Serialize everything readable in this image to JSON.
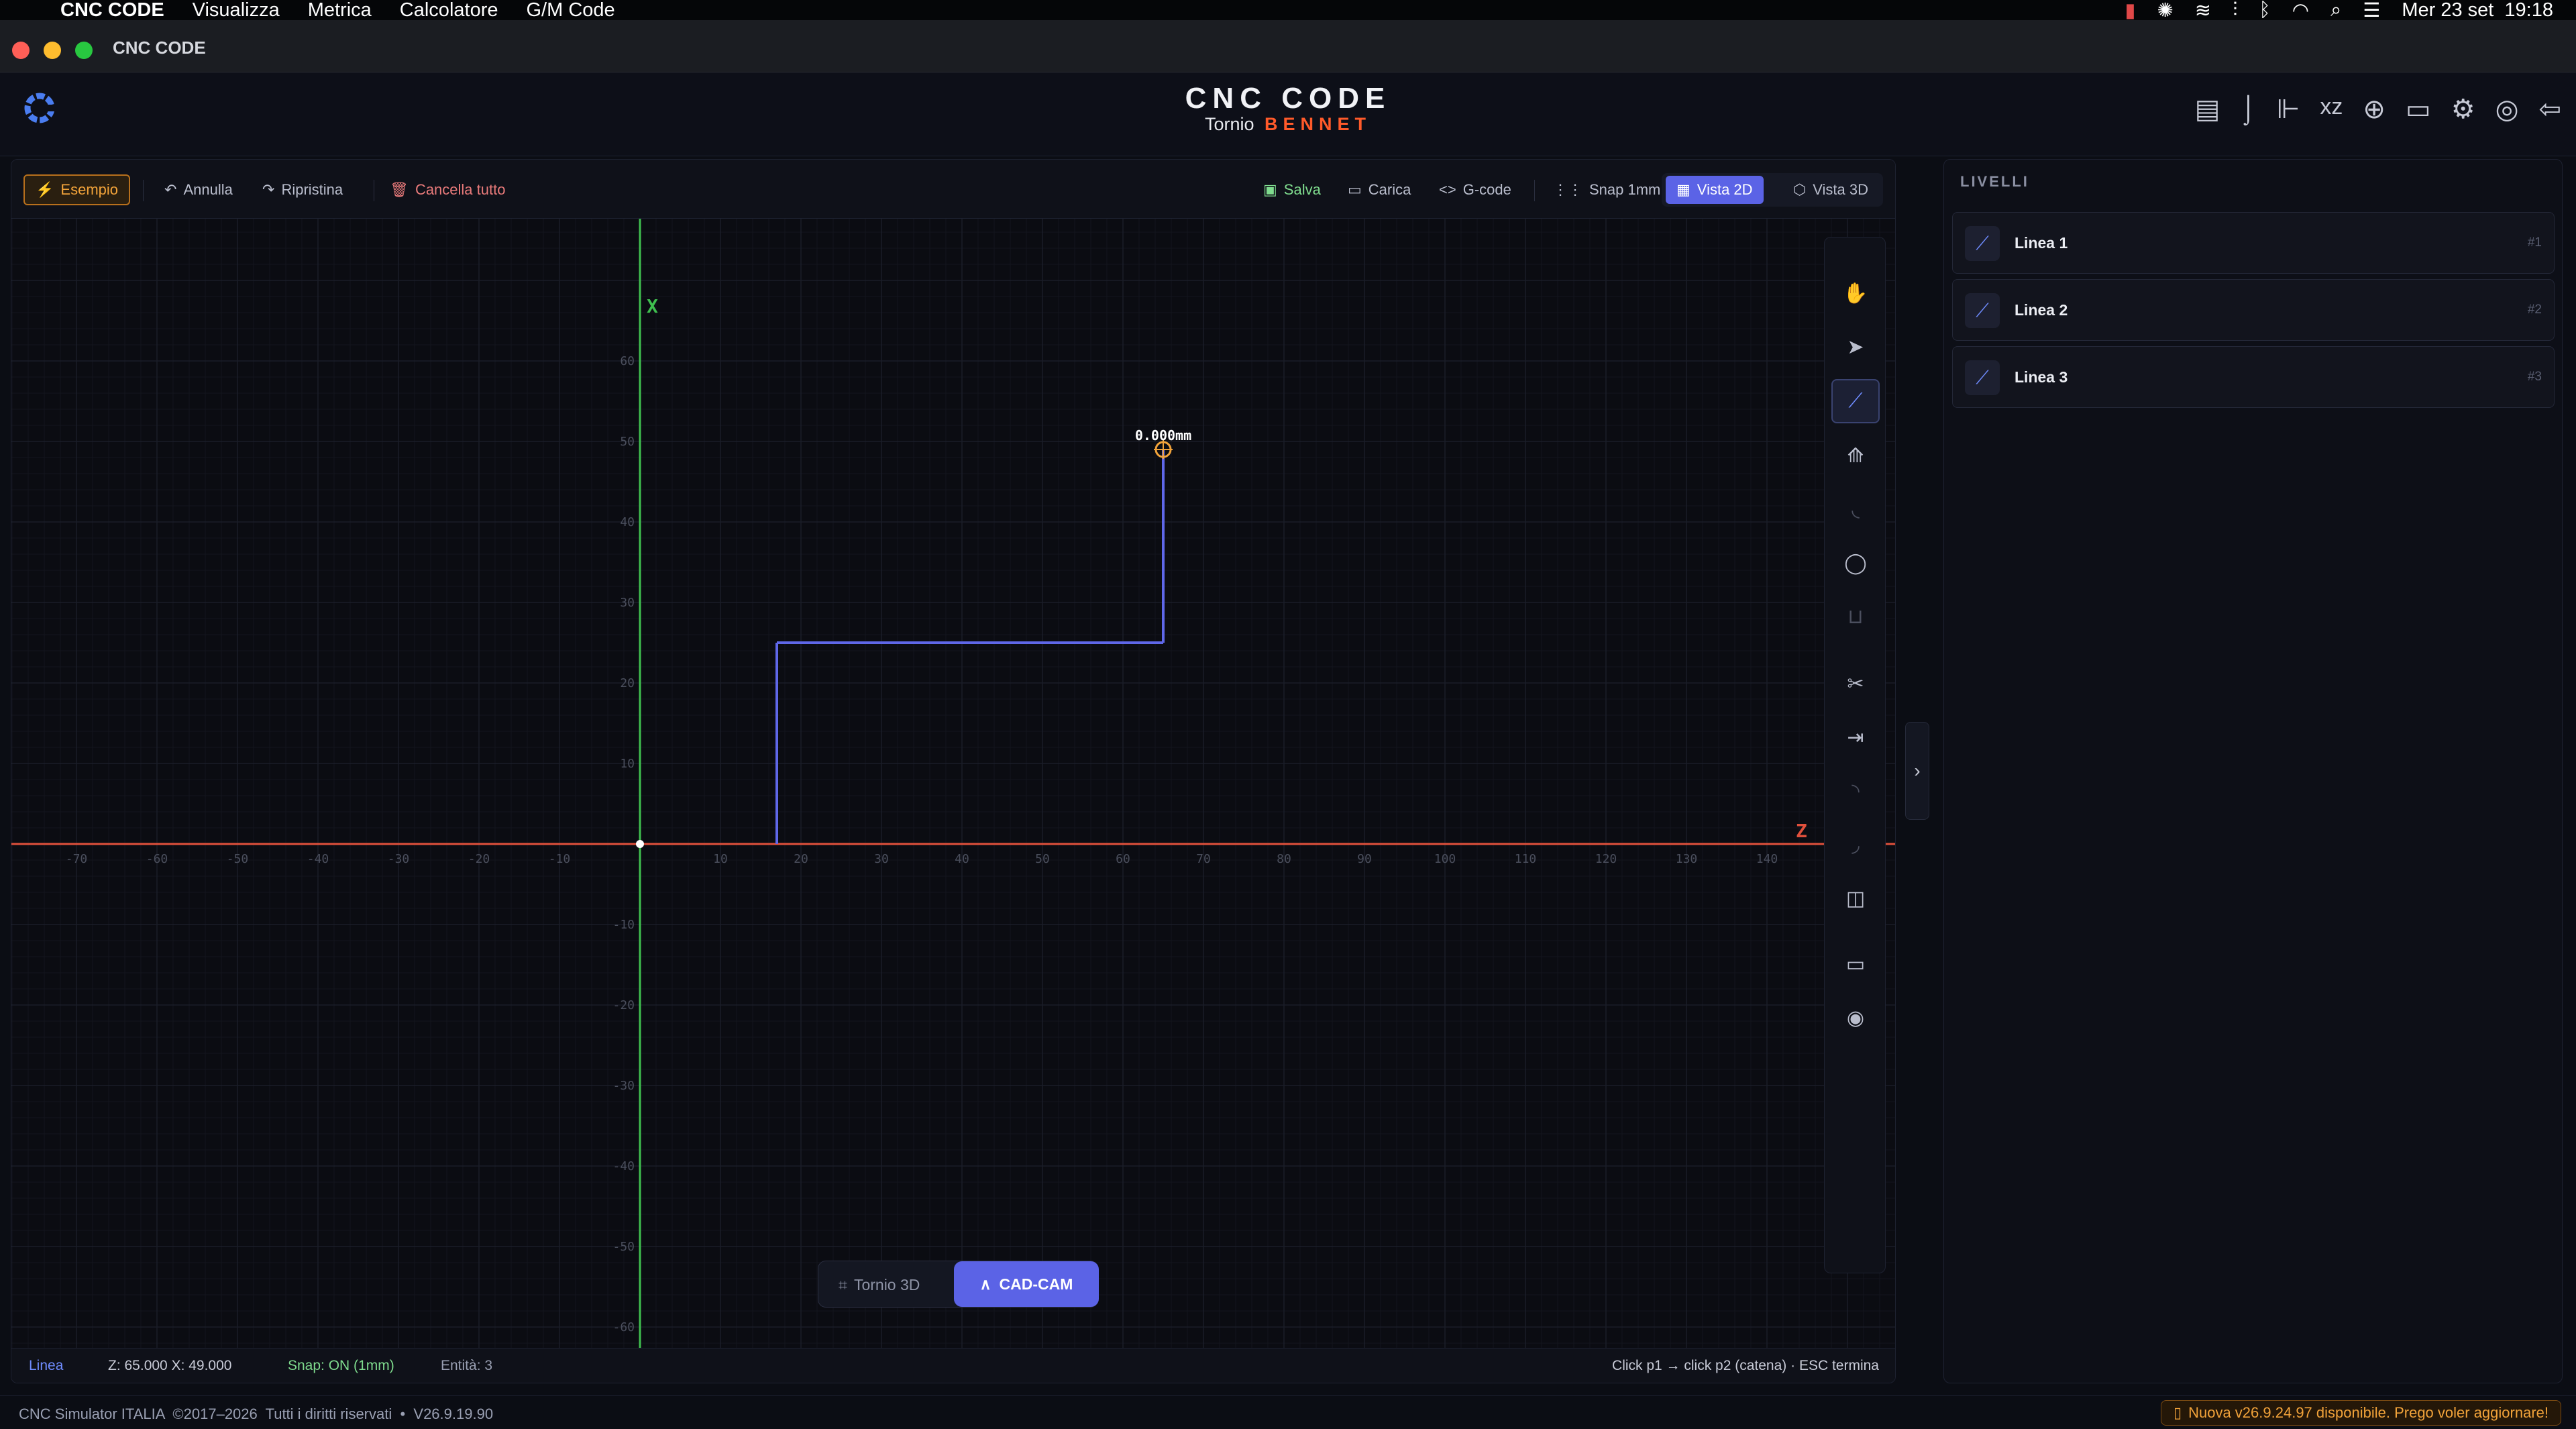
{
  "menubar": {
    "app": "CNC CODE",
    "items": [
      "Visualizza",
      "Metrica",
      "Calcolatore",
      "G/M Code"
    ],
    "clock": "Mer 23 set  19:18"
  },
  "window": {
    "title": "CNC CODE"
  },
  "header": {
    "brand": "CNC CODE",
    "subtitle_left": "Tornio",
    "subtitle_right": "BENNET"
  },
  "toolbar": {
    "example": "Esempio",
    "undo": "Annulla",
    "redo": "Ripristina",
    "clear": "Cancella tutto",
    "save": "Salva",
    "load": "Carica",
    "gcode": "G-code",
    "snap": "Snap 1mm",
    "view2d": "Vista 2D",
    "view3d": "Vista 3D"
  },
  "canvas": {
    "x_axis_label": "X",
    "z_axis_label": "Z",
    "z_ticks": [
      "-70",
      "-60",
      "-50",
      "-40",
      "-30",
      "-20",
      "-10",
      "10",
      "20",
      "30",
      "40",
      "50",
      "60",
      "70",
      "80",
      "90",
      "100",
      "110",
      "120",
      "130",
      "140"
    ],
    "x_ticks": [
      "60",
      "50",
      "40",
      "30",
      "20",
      "10",
      "-10",
      "-20",
      "-30",
      "-40",
      "-50",
      "-60"
    ],
    "cursor_readout": "0.000mm",
    "entities": [
      {
        "z1": 17,
        "x1": 0,
        "z2": 17,
        "x2": 25
      },
      {
        "z1": 17,
        "x1": 25,
        "z2": 65,
        "x2": 25
      },
      {
        "z1": 65,
        "x1": 25,
        "z2": 65,
        "x2": 49
      }
    ],
    "cursor": {
      "z": 65,
      "x": 49
    }
  },
  "mode_switch": {
    "lathe3d": "Tornio 3D",
    "cadcam": "CAD-CAM"
  },
  "status": {
    "tool": "Linea",
    "coords": "Z: 65.000 X: 49.000",
    "snap": "Snap: ON (1mm)",
    "entities": "Entità: 3",
    "hint": "Click p1 → click p2 (catena) · ESC termina"
  },
  "levels": {
    "title": "LIVELLI",
    "items": [
      {
        "label": "Linea 1",
        "num": "#1"
      },
      {
        "label": "Linea 2",
        "num": "#2"
      },
      {
        "label": "Linea 3",
        "num": "#3"
      }
    ]
  },
  "footer": {
    "copyright": "CNC Simulator ITALIA  ©2017–2026  Tutti i diritti riservati  •  V26.9.19.90",
    "update": "Nuova v26.9.24.97 disponibile. Prego voler aggiornare!"
  },
  "colors": {
    "accent": "#5b63e6",
    "axis_z": "#e0503c",
    "axis_x": "#3fbf4f",
    "brand_orange": "#ff5a2a",
    "warn": "#f2a33a"
  }
}
